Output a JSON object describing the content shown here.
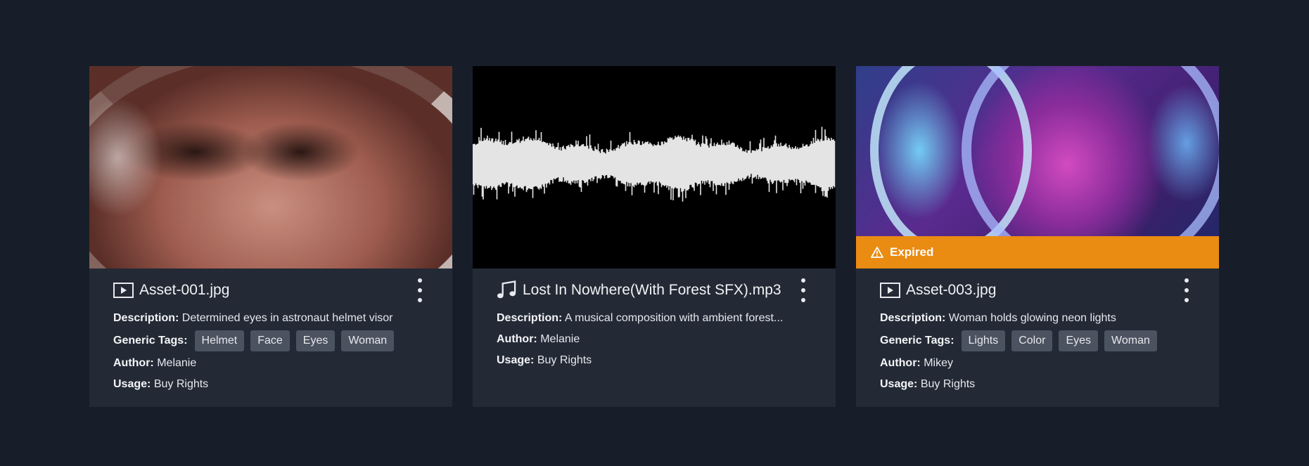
{
  "labels": {
    "description": "Description:",
    "tags": "Generic Tags:",
    "author": "Author:",
    "usage": "Usage:"
  },
  "cards": [
    {
      "type_icon": "video-icon",
      "title": "Asset-001.jpg",
      "description": "Determined eyes in astronaut helmet visor",
      "tags": [
        "Helmet",
        "Face",
        "Eyes",
        "Woman"
      ],
      "author": "Melanie",
      "usage": "Buy Rights"
    },
    {
      "type_icon": "music-note-icon",
      "title": "Lost In Nowhere(With Forest SFX).mp3",
      "description": "A musical composition with ambient forest...",
      "author": "Melanie",
      "usage": "Buy Rights"
    },
    {
      "type_icon": "video-icon",
      "title": "Asset-003.jpg",
      "status": "Expired",
      "status_icon": "warning-icon",
      "description": "Woman holds glowing neon lights",
      "tags": [
        "Lights",
        "Color",
        "Eyes",
        "Woman"
      ],
      "author": "Mikey",
      "usage": "Buy Rights"
    }
  ],
  "colors": {
    "background": "#181e29",
    "card": "#232a36",
    "tag": "#4b5260",
    "expired": "#ea8b12"
  }
}
